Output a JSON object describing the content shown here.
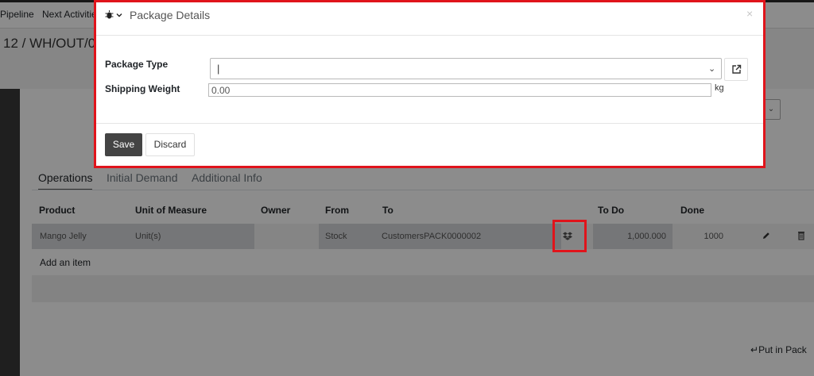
{
  "topbar": {
    "nav_items": [
      "Pipeline",
      "Next Activitie"
    ]
  },
  "breadcrumb": "12 /  WH/OUT/00",
  "tabs": [
    {
      "label": "Operations",
      "active": true
    },
    {
      "label": "Initial Demand",
      "active": false
    },
    {
      "label": "Additional Info",
      "active": false
    }
  ],
  "table": {
    "headers": [
      "Product",
      "Unit of Measure",
      "Owner",
      "From",
      "To",
      "To Do",
      "Done"
    ],
    "rows": [
      {
        "product": "Mango Jelly",
        "uom": "Unit(s)",
        "owner": "",
        "from": "Stock",
        "to": "CustomersPACK0000002",
        "todo": "1,000.000",
        "done": "1000"
      }
    ],
    "add_item_label": "Add an item"
  },
  "put_in_pack_label": "Put in Pack",
  "modal": {
    "title": "Package Details",
    "close_glyph": "×",
    "package_type_label": "Package Type",
    "package_type_value": "|",
    "shipping_weight_label": "Shipping Weight",
    "shipping_weight_value": "0.00",
    "weight_unit": "kg",
    "save_label": "Save",
    "discard_label": "Discard"
  },
  "icons": {
    "debug": "bug-icon",
    "caret": "chevron-down-icon",
    "external": "external-link-icon",
    "edit": "pencil-icon",
    "delete": "trash-icon",
    "package": "dropbox-icon"
  },
  "colors": {
    "highlight": "#e0141b",
    "primary_button": "#444444"
  }
}
